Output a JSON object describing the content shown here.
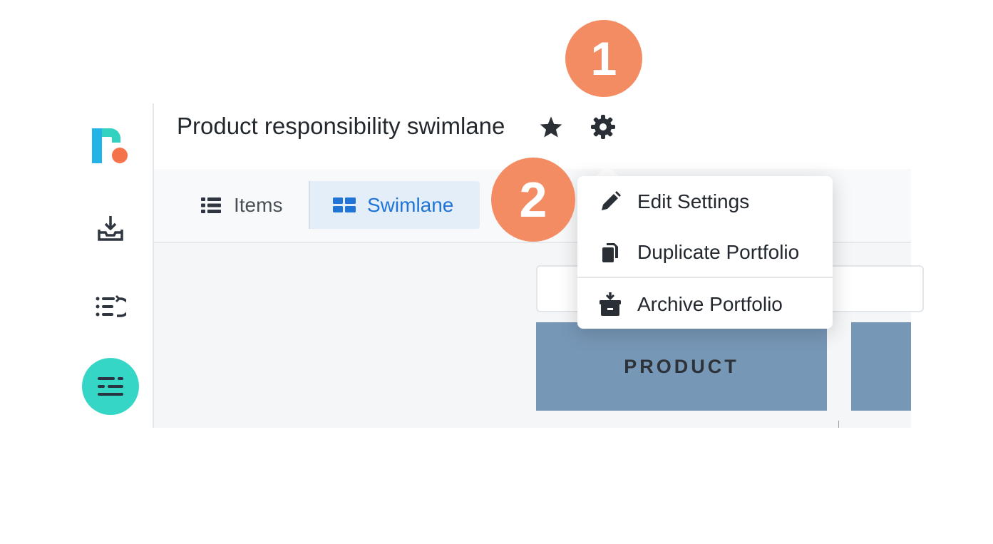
{
  "header": {
    "title": "Product responsibility swimlane"
  },
  "icons": {
    "logo": "app-logo",
    "rail": [
      "inbox-download-icon",
      "list-redo-icon",
      "sliders-lines-icon"
    ],
    "header": [
      "star-icon",
      "gear-icon"
    ]
  },
  "tabs": [
    {
      "label": "Items",
      "icon": "list-icon",
      "selected": false
    },
    {
      "label": "Swimlane",
      "icon": "grid-icon",
      "selected": true
    }
  ],
  "settings_menu": {
    "items": [
      {
        "label": "Edit Settings",
        "icon": "pencil-icon"
      },
      {
        "label": "Duplicate Portfolio",
        "icon": "copy-icon"
      },
      {
        "label": "Archive Portfolio",
        "icon": "archive-box-icon"
      }
    ]
  },
  "swimlanes": [
    {
      "label": "PRODUCT"
    }
  ],
  "annotations": {
    "step1": "1",
    "step2": "2"
  },
  "colors": {
    "accent": "#36d6c6",
    "selected_tab_bg": "#e3eef9",
    "selected_tab_text": "#1f74d6",
    "lane": "#7797b7",
    "badge": "#f48c63"
  }
}
